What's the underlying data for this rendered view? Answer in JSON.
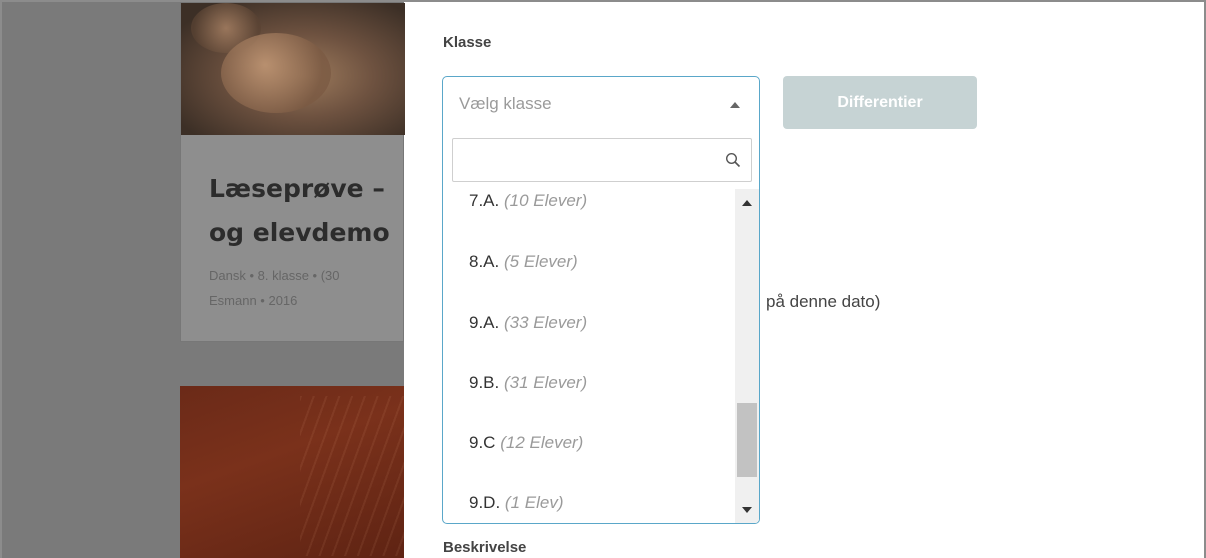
{
  "background_card": {
    "title": "Læseprøve –\nog elevdemo",
    "meta": "Dansk • 8. klasse • (30\nEsmann • 2016"
  },
  "form": {
    "class_label": "Klasse",
    "class_select": {
      "placeholder": "Vælg klasse",
      "search_value": "",
      "options": [
        {
          "name": "7.A.",
          "count": "(10 Elever)"
        },
        {
          "name": "8.A.",
          "count": "(5 Elever)"
        },
        {
          "name": "9.A.",
          "count": "(33 Elever)"
        },
        {
          "name": "9.B.",
          "count": "(31 Elever)"
        },
        {
          "name": "9.C",
          "count": "(12 Elever)"
        },
        {
          "name": "9.D.",
          "count": "(1 Elev)"
        }
      ],
      "scroll_position": 0.85
    },
    "differentiate_button": "Differentier",
    "date_note_partial": "på denne dato)",
    "description_label": "Beskrivelse"
  },
  "colors": {
    "select_border": "#5aa7c9",
    "button_disabled": "#c6d3d4",
    "backdrop": "#7a7a7a"
  },
  "icons": {
    "search": "search-icon",
    "select_caret": "caret-up-icon",
    "scroll_up": "scroll-up-icon",
    "scroll_down": "scroll-down-icon"
  }
}
